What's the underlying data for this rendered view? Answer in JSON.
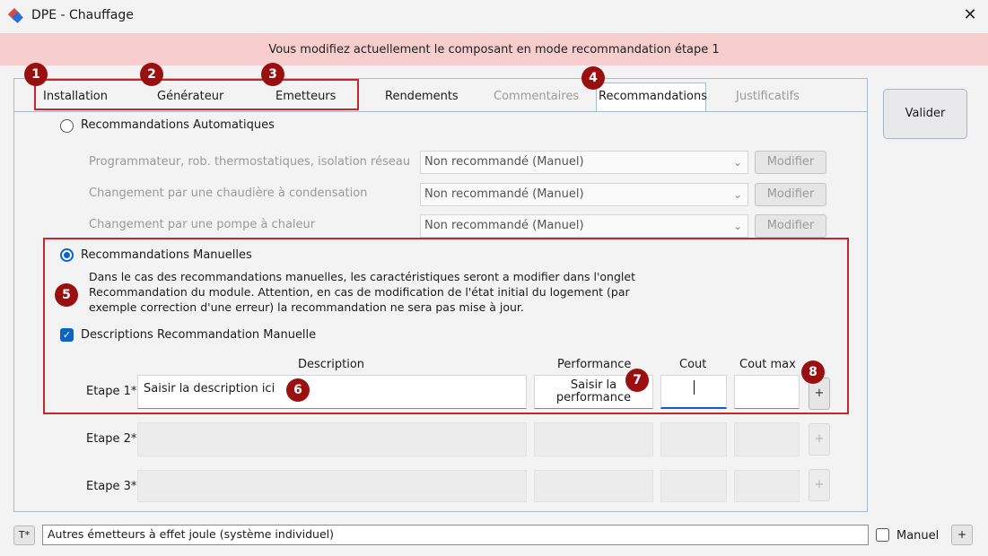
{
  "window": {
    "title": "DPE - Chauffage",
    "close_glyph": "✕"
  },
  "banner": {
    "text": "Vous modifiez actuellement le composant en mode recommandation étape 1",
    "color": "#f8cdcd"
  },
  "tabs": [
    {
      "label": "Installation",
      "disabled": false
    },
    {
      "label": "Générateur",
      "disabled": false
    },
    {
      "label": "Emetteurs",
      "disabled": false
    },
    {
      "label": "Rendements",
      "disabled": false
    },
    {
      "label": "Commentaires",
      "disabled": true
    },
    {
      "label": "Recommandations",
      "disabled": false,
      "active": true
    },
    {
      "label": "Justificatifs",
      "disabled": true
    }
  ],
  "badges": [
    "1",
    "2",
    "3",
    "4",
    "5",
    "6",
    "7",
    "8"
  ],
  "auto": {
    "label": "Recommandations Automatiques",
    "selected": false,
    "rows": [
      {
        "label": "Programmateur, rob. thermostatiques, isolation réseau",
        "value": "Non recommandé (Manuel)",
        "button": "Modifier"
      },
      {
        "label": "Changement par une chaudière à condensation",
        "value": "Non recommandé (Manuel)",
        "button": "Modifier"
      },
      {
        "label": "Changement par une pompe à chaleur",
        "value": "Non recommandé (Manuel)",
        "button": "Modifier"
      }
    ]
  },
  "manual": {
    "label": "Recommandations Manuelles",
    "selected": true,
    "info_lines": [
      "Dans le cas des recommandations manuelles, les caractéristiques seront a modifier dans l'onglet",
      "Recommandation du module. Attention, en cas de modification de l'état initial du logement (par",
      "exemple correction d'une erreur) la recommandation ne sera pas mise à jour."
    ],
    "checkbox_label": "Descriptions Recommandation Manuelle",
    "checkbox_checked": true,
    "columns": {
      "description": "Description",
      "performance": "Performance",
      "cout": "Cout",
      "cout_max": "Cout max"
    },
    "steps": [
      {
        "label": "Etape 1*",
        "description": "Saisir la description ici",
        "performance_line1": "Saisir la",
        "performance_line2": "performance",
        "cout": "",
        "cout_max": "",
        "enabled": true
      },
      {
        "label": "Etape 2*",
        "description": "",
        "performance_line1": "",
        "performance_line2": "",
        "cout": "",
        "cout_max": "",
        "enabled": false
      },
      {
        "label": "Etape 3*",
        "description": "",
        "performance_line1": "",
        "performance_line2": "",
        "cout": "",
        "cout_max": "",
        "enabled": false
      }
    ],
    "plus_glyph": "+"
  },
  "valider_label": "Valider",
  "footer": {
    "t_button": "T*",
    "text": "Autres émetteurs à effet joule (système individuel)",
    "manuel_label": "Manuel",
    "plus_glyph": "+"
  },
  "colors": {
    "accent": "#0a64c8",
    "badge": "#9a1010",
    "highlight_border": "#c8262d"
  }
}
